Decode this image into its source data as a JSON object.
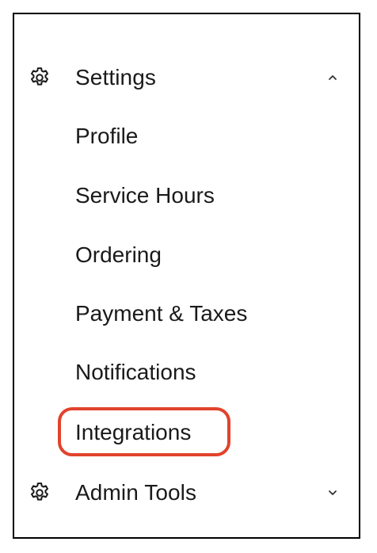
{
  "nav": {
    "settings": {
      "label": "Settings",
      "icon": "gear-icon",
      "chevron": "chevron-up-icon",
      "expanded": true,
      "items": [
        {
          "label": "Profile"
        },
        {
          "label": "Service Hours"
        },
        {
          "label": "Ordering"
        },
        {
          "label": "Payment & Taxes"
        },
        {
          "label": "Notifications"
        },
        {
          "label": "Integrations"
        }
      ]
    },
    "admin_tools": {
      "label": "Admin Tools",
      "icon": "gear-icon",
      "chevron": "chevron-down-icon",
      "expanded": false
    }
  },
  "highlight": {
    "target": "Integrations",
    "color": "#e1432c"
  }
}
